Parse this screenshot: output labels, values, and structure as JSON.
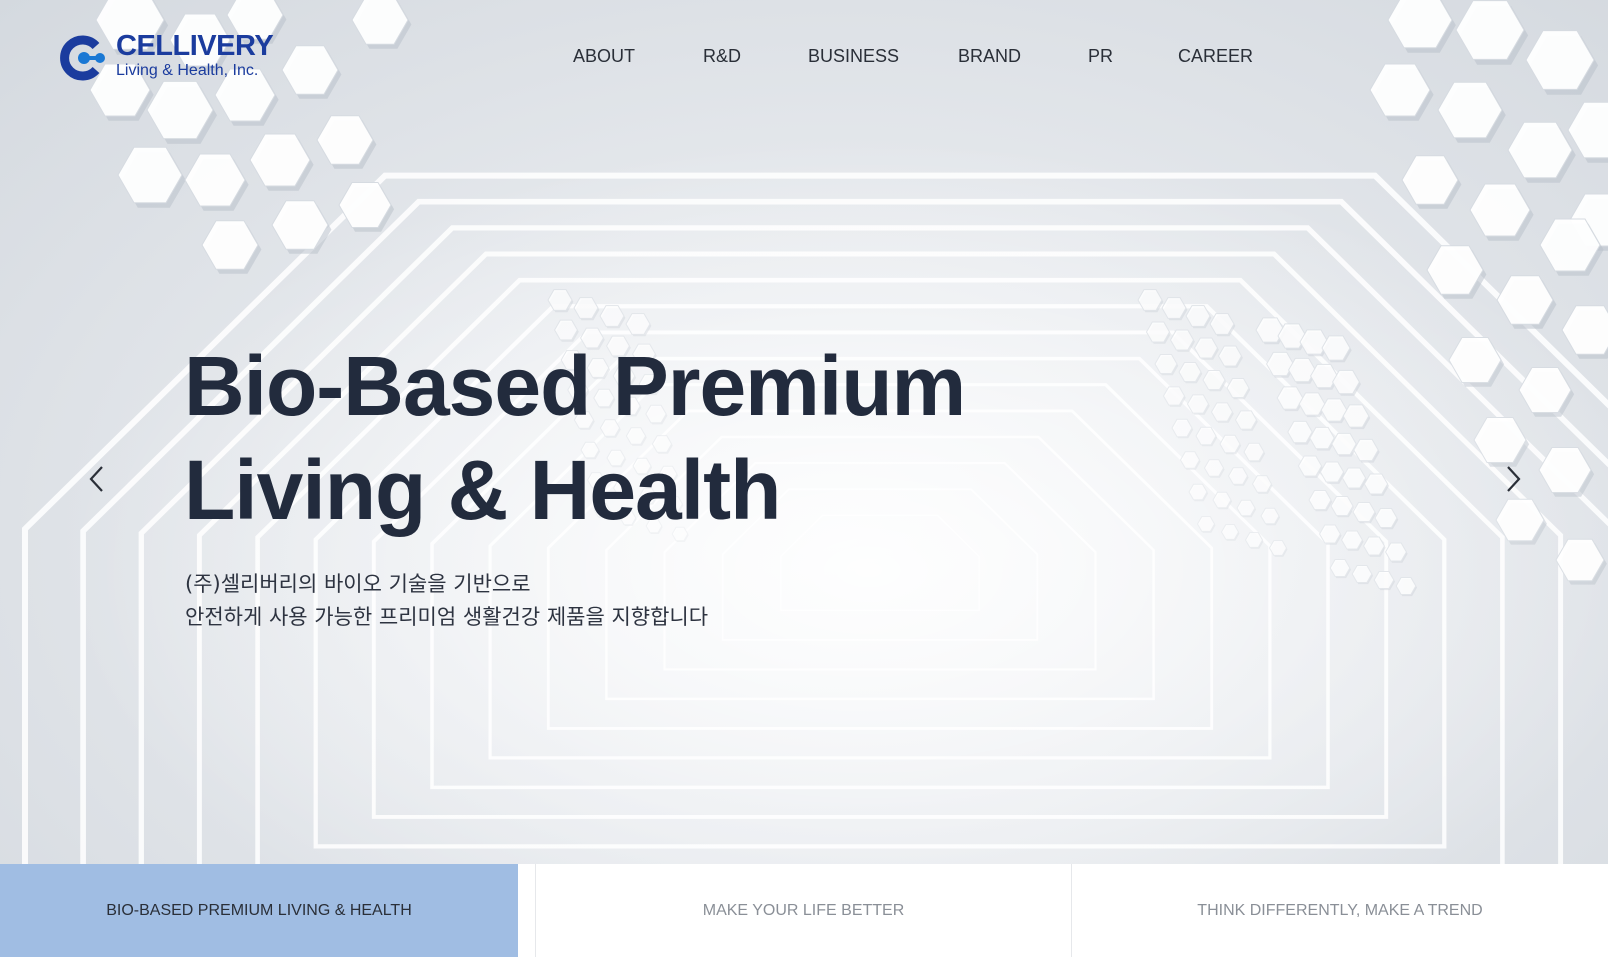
{
  "brand": {
    "name": "CELLIVERY",
    "tagline": "Living & Health, Inc.",
    "color": "#1b3c9e",
    "accent": "#1a78d4"
  },
  "nav": {
    "items": [
      {
        "label": "ABOUT"
      },
      {
        "label": "R&D"
      },
      {
        "label": "BUSINESS"
      },
      {
        "label": "BRAND"
      },
      {
        "label": "PR"
      },
      {
        "label": "CAREER"
      }
    ]
  },
  "hero": {
    "title_line1": "Bio-Based Premium",
    "title_line2": "Living & Health",
    "sub_line1": "(주)셀리버리의 바이오 기술을 기반으로",
    "sub_line2": "안전하게 사용 가능한 프리미엄 생활건강 제품을 지향합니다",
    "prev_icon": "chevron-left-icon",
    "next_icon": "chevron-right-icon"
  },
  "tabs": {
    "items": [
      {
        "label": "BIO-BASED PREMIUM LIVING & HEALTH",
        "active": true
      },
      {
        "label": "MAKE YOUR LIFE BETTER",
        "active": false
      },
      {
        "label": "THINK DIFFERENTLY, MAKE A TREND",
        "active": false
      }
    ],
    "active_color": "#a0bde3"
  }
}
